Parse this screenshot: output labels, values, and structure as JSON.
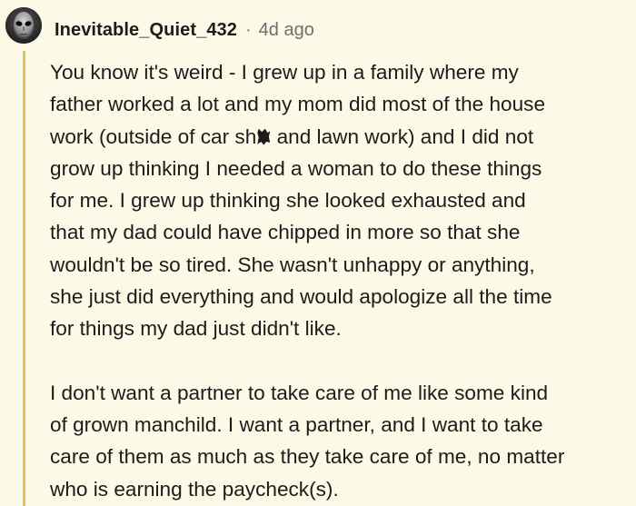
{
  "comment": {
    "username": "Inevitable_Quiet_432",
    "separator": "·",
    "timestamp": "4d ago",
    "paragraph1": {
      "line1": "You know it's weird - I grew up in a family where my",
      "line2": "father worked a lot and my mom did most of the house",
      "line3_before": "work (outside of car sh",
      "line3_after": " and lawn work) and I did not",
      "line4": "grow up thinking I needed a woman to do these things",
      "line5": "for me. I grew up thinking she looked exhausted and",
      "line6": "that my dad could have chipped in more so that she",
      "line7": "wouldn't be so tired. She wasn't unhappy or anything,",
      "line8": "she just did everything and would apologize all the time",
      "line9": "for things my dad just didn't like."
    },
    "paragraph2": {
      "line1": "I don't want a partner to take care of me like some kind",
      "line2": "of grown manchild. I want a partner, and I want to take",
      "line3": "care of them as much as they take care of me, no matter",
      "line4": "who is earning the paycheck(s)."
    }
  },
  "colors": {
    "background": "#fcf9e6",
    "thread_line": "#e6c25a",
    "text": "#1c1c1c",
    "meta": "#6e6e6e"
  },
  "icons": {
    "avatar": "alien-face-avatar",
    "censor": "censor-scribble"
  }
}
